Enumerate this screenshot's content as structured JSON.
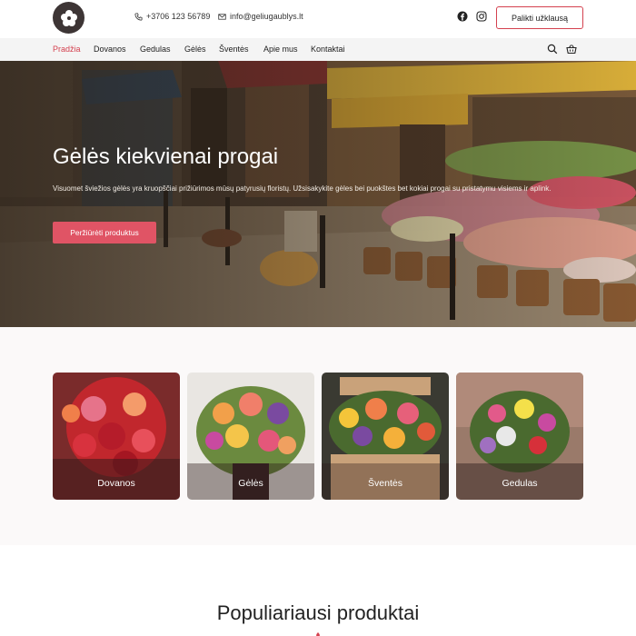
{
  "header": {
    "phone": "+3706 123 56789",
    "email": "info@geliugaublys.lt",
    "cta_label": "Palikti užklausą"
  },
  "nav": {
    "items": [
      "Pradžia",
      "Dovanos",
      "Gedulas",
      "Gėlės",
      "Šventės",
      "Apie mus",
      "Kontaktai"
    ],
    "active": "Pradžia"
  },
  "hero": {
    "title": "Gėlės kiekvienai progai",
    "text": "Visuomet šviežios gėlės yra kruopščiai prižiūrimos mūsų patyrusių floristų. Užsisakykite gėles bei puokštes bet kokiai progai su pristatymu visiems ir aplink.",
    "button_label": "Peržiūrėti produktus"
  },
  "categories": [
    {
      "label": "Dovanos"
    },
    {
      "label": "Gėlės"
    },
    {
      "label": "Šventės"
    },
    {
      "label": "Gedulas"
    }
  ],
  "popular": {
    "title": "Populiariausi produktai"
  },
  "colors": {
    "accent": "#d4414f",
    "button": "#e05465"
  }
}
